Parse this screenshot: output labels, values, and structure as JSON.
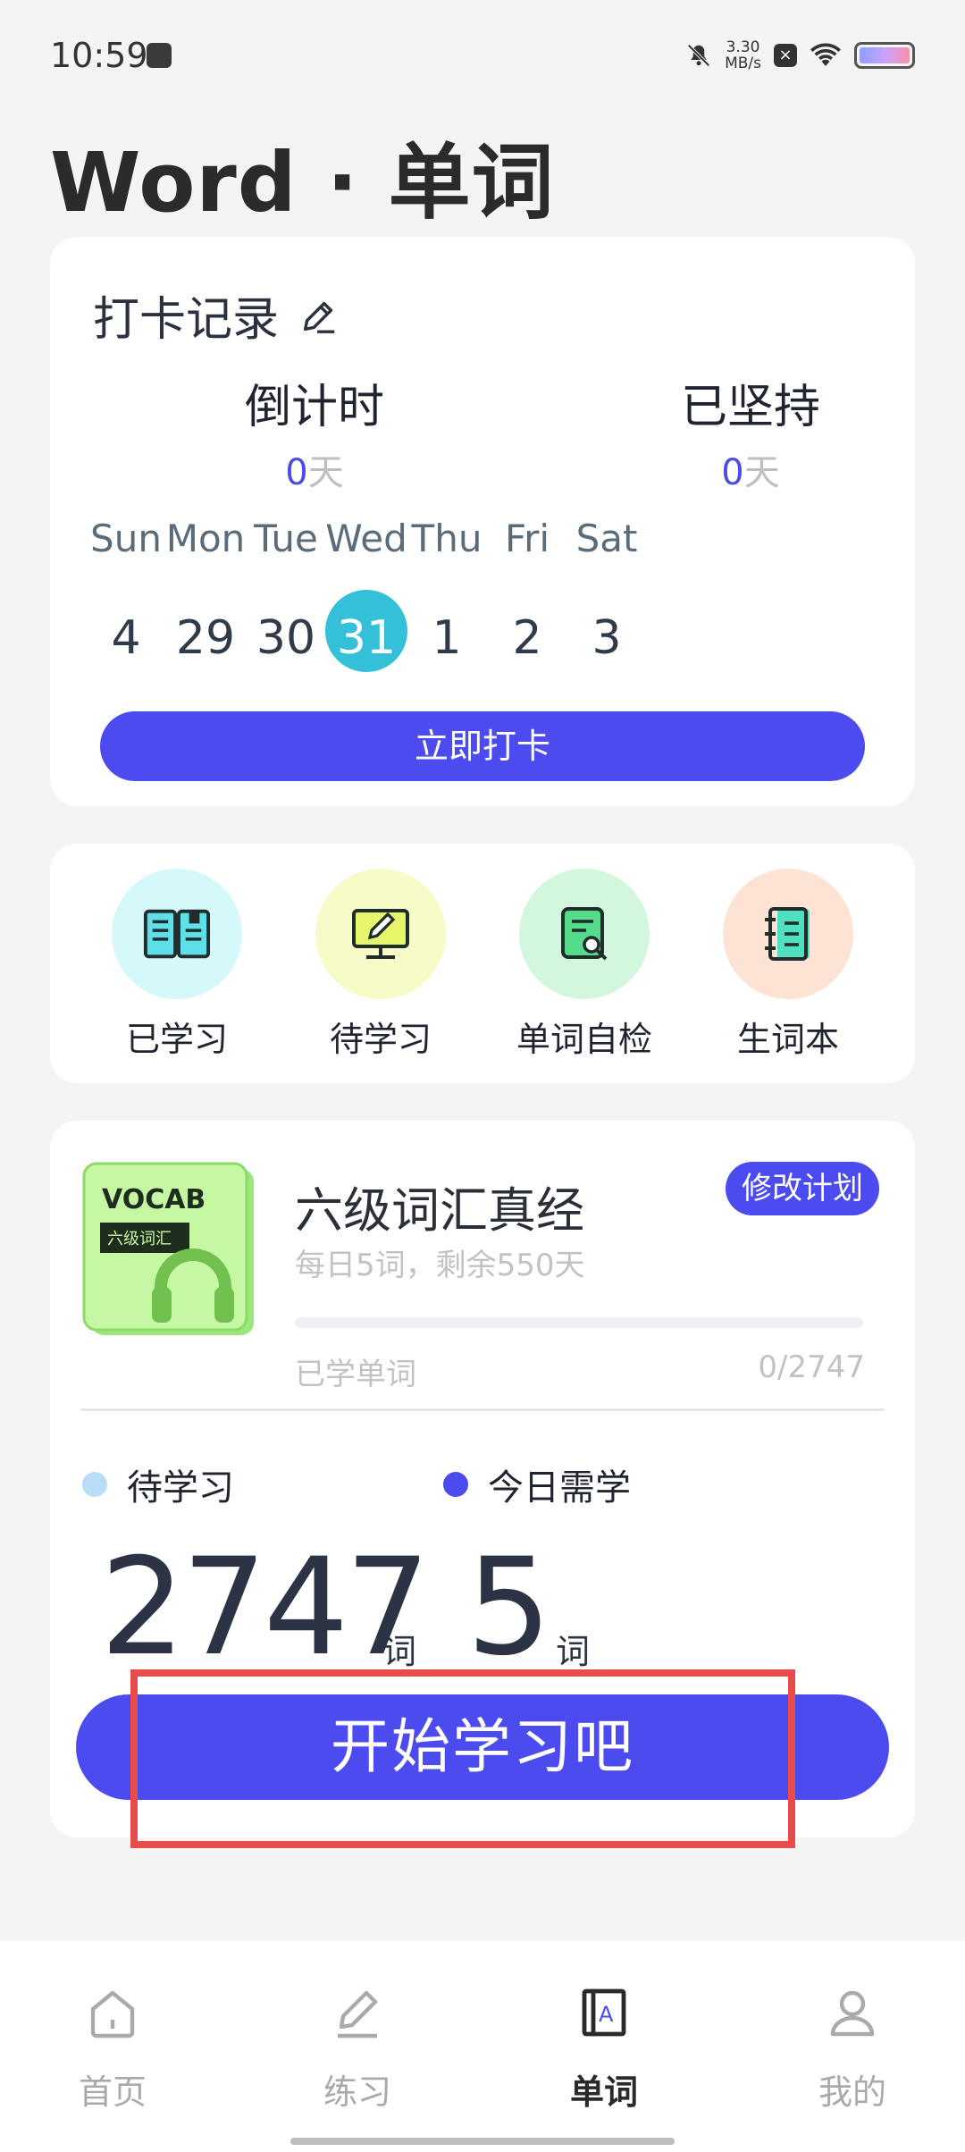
{
  "status_bar": {
    "time": "10:59",
    "net_speed_value": "3.30",
    "net_speed_unit": "MB/s"
  },
  "page": {
    "title": "Word · 单词"
  },
  "checkin": {
    "title": "打卡记录",
    "countdown_label": "倒计时",
    "countdown_value": "0",
    "countdown_unit": "天",
    "persist_label": "已坚持",
    "persist_value": "0",
    "persist_unit": "天",
    "days": [
      {
        "name": "Sun",
        "date": "4"
      },
      {
        "name": "Mon",
        "date": "29"
      },
      {
        "name": "Tue",
        "date": "30"
      },
      {
        "name": "Wed",
        "date": "31"
      },
      {
        "name": "Thu",
        "date": "1"
      },
      {
        "name": "Fri",
        "date": "2"
      },
      {
        "name": "Sat",
        "date": "3"
      }
    ],
    "today_index": 3,
    "button_label": "立即打卡"
  },
  "shortcuts": [
    {
      "label": "已学习",
      "icon": "book-open-icon",
      "bg": "#d5f8fb"
    },
    {
      "label": "待学习",
      "icon": "monitor-pen-icon",
      "bg": "#f6fbc8"
    },
    {
      "label": "单词自检",
      "icon": "document-search-icon",
      "bg": "#d2f7dc"
    },
    {
      "label": "生词本",
      "icon": "notebook-icon",
      "bg": "#fde3d3"
    }
  ],
  "plan": {
    "cover_title": "VOCAB",
    "cover_subtitle": "六级词汇",
    "title": "六级词汇真经",
    "subtitle": "每日5词，剩余550天",
    "modify_label": "修改计划",
    "learned_label": "已学单词",
    "learned_count": "0/2747",
    "progress_fraction": 0,
    "pending_label": "待学习",
    "today_label": "今日需学",
    "pending_count": "2747",
    "today_count": "5",
    "word_unit": "词",
    "start_label": "开始学习吧"
  },
  "colors": {
    "accent": "#4b4bf0",
    "today_circle": "#34c0d8",
    "pending_dot": "#b9dcf7",
    "today_dot": "#4b4bf0",
    "highlight": "#e94a4a"
  },
  "nav": {
    "items": [
      {
        "label": "首页",
        "icon": "home-icon"
      },
      {
        "label": "练习",
        "icon": "pencil-icon"
      },
      {
        "label": "单词",
        "icon": "dictionary-icon"
      },
      {
        "label": "我的",
        "icon": "user-icon"
      }
    ],
    "active_index": 2
  }
}
